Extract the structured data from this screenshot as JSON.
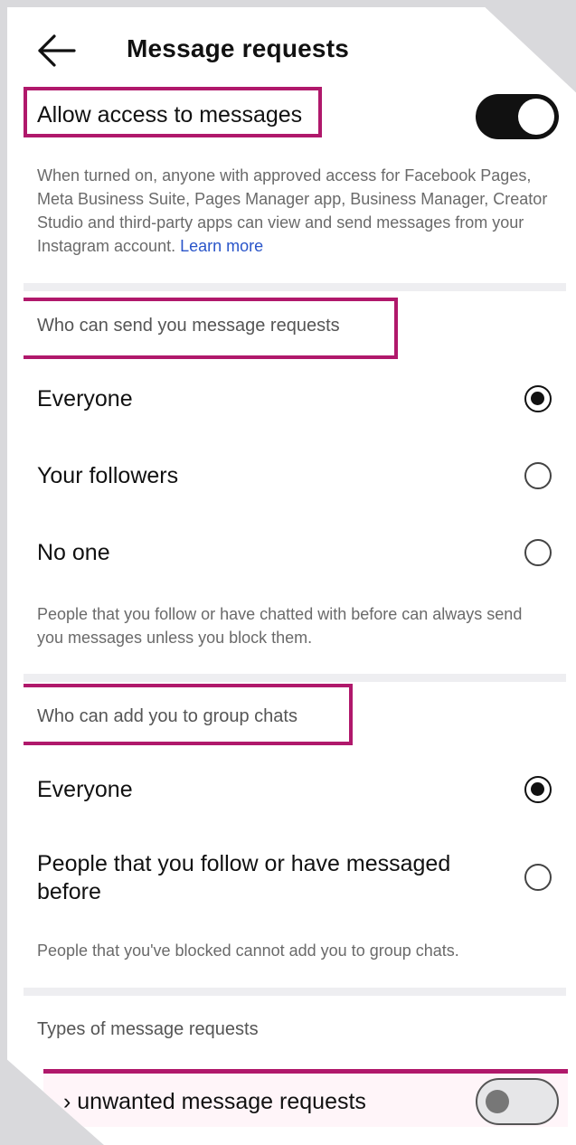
{
  "header": {
    "title": "Message requests",
    "back_icon": "back-arrow-icon"
  },
  "access": {
    "label": "Allow access to messages",
    "toggle_state": "on",
    "description": "When turned on, anyone with approved access for Facebook Pages, Meta Business Suite, Pages Manager app, Business Manager, Creator Studio and third-party apps can view and send messages from your Instagram account.",
    "learn_more": "Learn more"
  },
  "requests_section": {
    "title": "Who can send you message requests",
    "options": [
      {
        "label": "Everyone",
        "selected": true
      },
      {
        "label": "Your followers",
        "selected": false
      },
      {
        "label": "No one",
        "selected": false
      }
    ],
    "note": "People that you follow or have chatted with before can always send you messages unless you block them."
  },
  "group_section": {
    "title": "Who can add you to group chats",
    "options": [
      {
        "label": "Everyone",
        "selected": true
      },
      {
        "label": "People that you follow or have messaged before",
        "selected": false
      }
    ],
    "note": "People that you've blocked cannot add you to group chats."
  },
  "types_section": {
    "title": "Types of message requests",
    "item_label": "› unwanted message requests",
    "toggle_state": "off"
  },
  "colors": {
    "highlight": "#b0186b",
    "link": "#2a55c9",
    "toggle_on": "#111111"
  }
}
